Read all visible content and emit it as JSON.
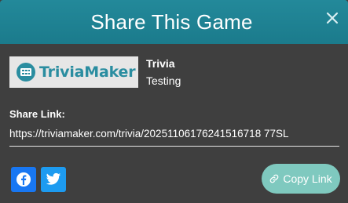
{
  "dialog": {
    "title": "Share This Game",
    "close_icon": "close-icon"
  },
  "logo": {
    "text": "TriviaMaker",
    "icon": "triviamaker-logo-icon"
  },
  "game": {
    "title": "Trivia",
    "subtitle": "Testing"
  },
  "share": {
    "label": "Share Link:",
    "url": "https://triviamaker.com/trivia/20251106176241516718 77SL"
  },
  "social": {
    "facebook_icon": "facebook-icon",
    "twitter_icon": "twitter-icon"
  },
  "copy": {
    "label": "Copy Link",
    "icon": "link-icon"
  },
  "colors": {
    "header": "#1f8393",
    "body": "#3f3f3f",
    "facebook": "#1877f2",
    "twitter": "#1d9bf0",
    "copy_button": "#7fc9bf"
  }
}
